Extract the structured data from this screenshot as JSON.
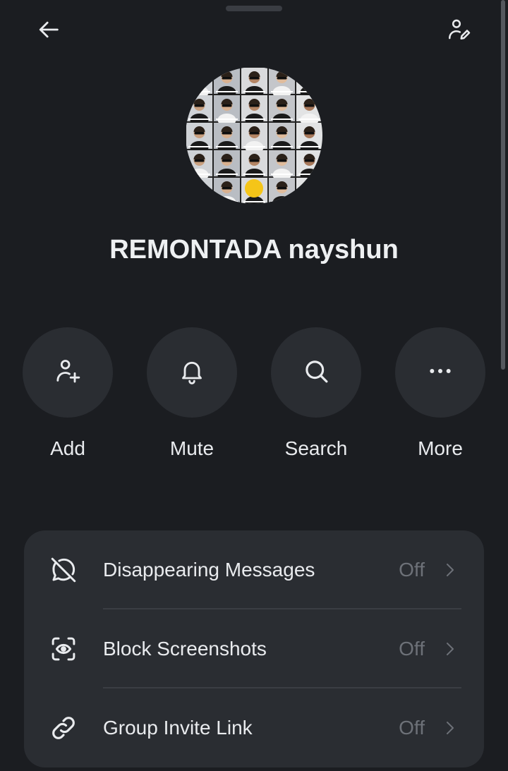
{
  "header": {
    "back_icon": "arrow-left-icon",
    "edit_icon": "person-edit-icon"
  },
  "group": {
    "name": "REMONTADA nayshun",
    "avatar_desc": "collage-of-headshots"
  },
  "actions": [
    {
      "label": "Add",
      "icon": "person-plus-icon"
    },
    {
      "label": "Mute",
      "icon": "bell-icon"
    },
    {
      "label": "Search",
      "icon": "search-icon"
    },
    {
      "label": "More",
      "icon": "ellipsis-icon"
    }
  ],
  "settings": [
    {
      "label": "Disappearing Messages",
      "value": "Off",
      "icon": "timer-off-icon"
    },
    {
      "label": "Block Screenshots",
      "value": "Off",
      "icon": "screenshot-eye-icon"
    },
    {
      "label": "Group Invite Link",
      "value": "Off",
      "icon": "link-icon"
    }
  ],
  "colors": {
    "background": "#1b1d21",
    "surface": "#2a2d32",
    "text": "#e9ebee",
    "muted": "#6d7178"
  }
}
